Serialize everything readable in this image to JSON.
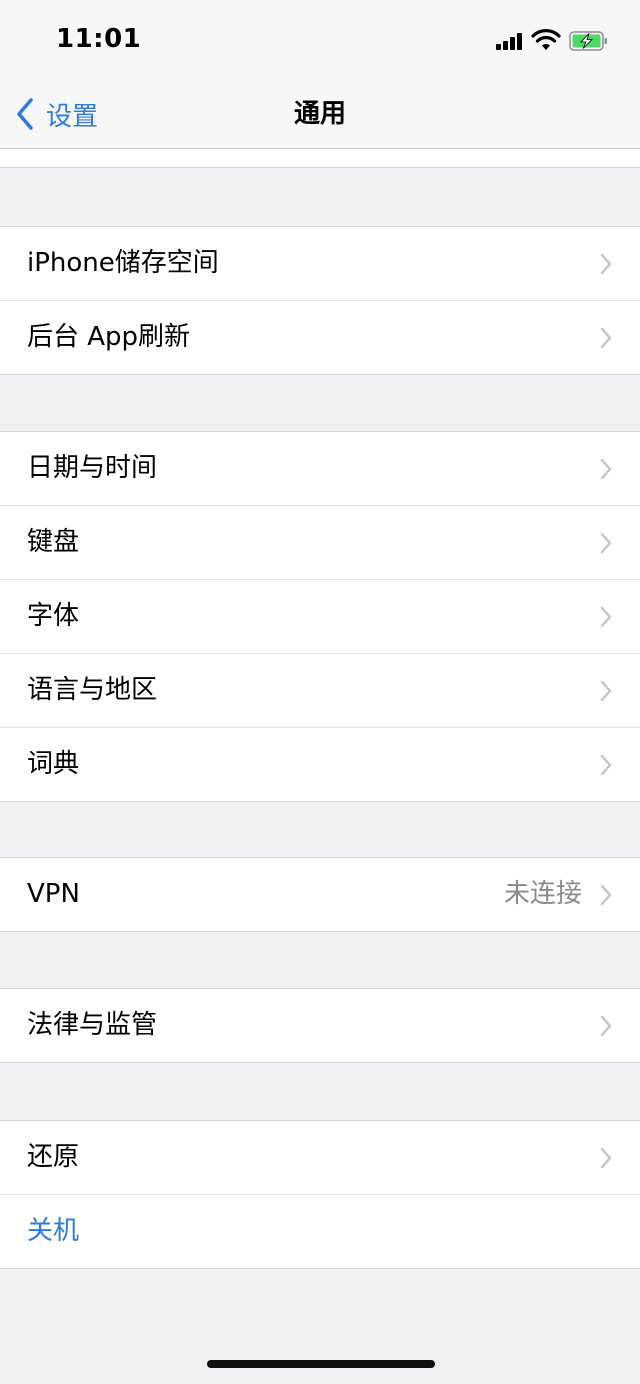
{
  "status": {
    "time": "11:01"
  },
  "nav": {
    "back_label": "设置",
    "title": "通用"
  },
  "groups": {
    "storage": [
      {
        "label": "iPhone储存空间"
      },
      {
        "label": "后台 App刷新"
      }
    ],
    "locale": [
      {
        "label": "日期与时间"
      },
      {
        "label": "键盘"
      },
      {
        "label": "字体"
      },
      {
        "label": "语言与地区"
      },
      {
        "label": "词典"
      }
    ],
    "vpn": [
      {
        "label": "VPN",
        "value": "未连接"
      }
    ],
    "legal": [
      {
        "label": "法律与监管"
      }
    ],
    "reset": [
      {
        "label": "还原"
      },
      {
        "label": "关机"
      }
    ]
  },
  "colors": {
    "accent": "#2f7bd6",
    "background": "#efeff4",
    "battery_green": "#4cd964"
  }
}
